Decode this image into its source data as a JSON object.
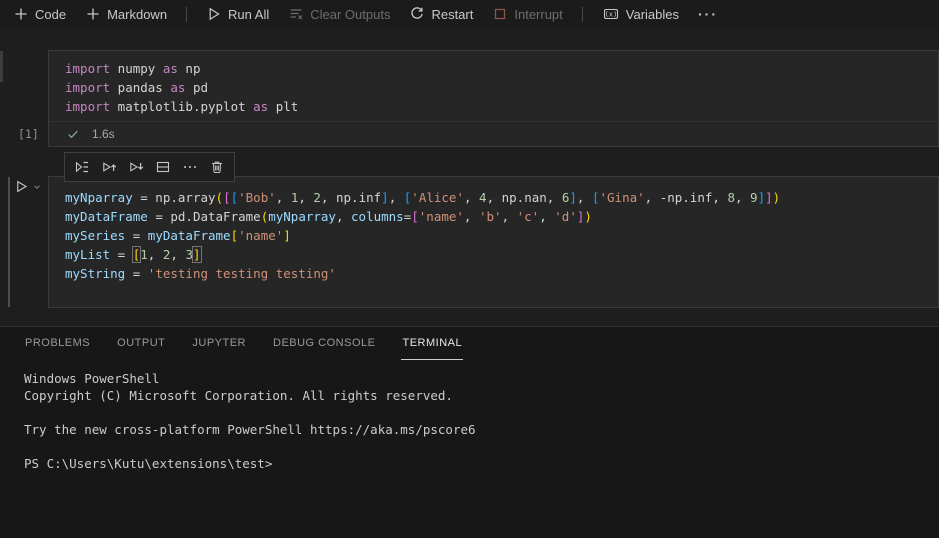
{
  "colors": {
    "kw": "#C586C0",
    "txt": "#D4D4D4",
    "var": "#9CDCFE",
    "str": "#CE9178",
    "num": "#B5CEA8",
    "b1": "#FFD700",
    "b2": "#DA70D6",
    "b3": "#179FFF",
    "success_check": "#7FAE87",
    "interrupt_icon": "#8A564C"
  },
  "toolbar": {
    "code_label": "Code",
    "markdown_label": "Markdown",
    "run_all_label": "Run All",
    "clear_outputs_label": "Clear Outputs",
    "restart_label": "Restart",
    "interrupt_label": "Interrupt",
    "variables_label": "Variables",
    "more_label": "···"
  },
  "cell1": {
    "execution_count": "[1]",
    "status_time": "1.6s",
    "lines": [
      [
        {
          "c": "kw",
          "t": "import"
        },
        {
          "c": "txt",
          "t": " numpy "
        },
        {
          "c": "kw",
          "t": "as"
        },
        {
          "c": "txt",
          "t": " np"
        }
      ],
      [
        {
          "c": "kw",
          "t": "import"
        },
        {
          "c": "txt",
          "t": " pandas "
        },
        {
          "c": "kw",
          "t": "as"
        },
        {
          "c": "txt",
          "t": " pd"
        }
      ],
      [
        {
          "c": "kw",
          "t": "import"
        },
        {
          "c": "txt",
          "t": " matplotlib.pyplot "
        },
        {
          "c": "kw",
          "t": "as"
        },
        {
          "c": "txt",
          "t": " plt"
        }
      ]
    ]
  },
  "cell2": {
    "lines": [
      [
        {
          "c": "var",
          "t": "myNparray"
        },
        {
          "c": "txt",
          "t": " = np.array"
        },
        {
          "c": "b1",
          "t": "("
        },
        {
          "c": "b2",
          "t": "["
        },
        {
          "c": "b3",
          "t": "["
        },
        {
          "c": "str",
          "t": "'Bob'"
        },
        {
          "c": "txt",
          "t": ", "
        },
        {
          "c": "num",
          "t": "1"
        },
        {
          "c": "txt",
          "t": ", "
        },
        {
          "c": "num",
          "t": "2"
        },
        {
          "c": "txt",
          "t": ", np.inf"
        },
        {
          "c": "b3",
          "t": "]"
        },
        {
          "c": "txt",
          "t": ", "
        },
        {
          "c": "b3",
          "t": "["
        },
        {
          "c": "str",
          "t": "'Alice'"
        },
        {
          "c": "txt",
          "t": ", "
        },
        {
          "c": "num",
          "t": "4"
        },
        {
          "c": "txt",
          "t": ", np.nan, "
        },
        {
          "c": "num",
          "t": "6"
        },
        {
          "c": "b3",
          "t": "]"
        },
        {
          "c": "txt",
          "t": ", "
        },
        {
          "c": "b3",
          "t": "["
        },
        {
          "c": "str",
          "t": "'Gina'"
        },
        {
          "c": "txt",
          "t": ", -np.inf, "
        },
        {
          "c": "num",
          "t": "8"
        },
        {
          "c": "txt",
          "t": ", "
        },
        {
          "c": "num",
          "t": "9"
        },
        {
          "c": "b3",
          "t": "]"
        },
        {
          "c": "b2",
          "t": "]"
        },
        {
          "c": "b1",
          "t": ")"
        }
      ],
      [
        {
          "c": "var",
          "t": "myDataFrame"
        },
        {
          "c": "txt",
          "t": " = pd.DataFrame"
        },
        {
          "c": "b1",
          "t": "("
        },
        {
          "c": "var",
          "t": "myNparray"
        },
        {
          "c": "txt",
          "t": ", "
        },
        {
          "c": "var",
          "t": "columns"
        },
        {
          "c": "txt",
          "t": "="
        },
        {
          "c": "b2",
          "t": "["
        },
        {
          "c": "str",
          "t": "'name'"
        },
        {
          "c": "txt",
          "t": ", "
        },
        {
          "c": "str",
          "t": "'b'"
        },
        {
          "c": "txt",
          "t": ", "
        },
        {
          "c": "str",
          "t": "'c'"
        },
        {
          "c": "txt",
          "t": ", "
        },
        {
          "c": "str",
          "t": "'d'"
        },
        {
          "c": "b2",
          "t": "]"
        },
        {
          "c": "b1",
          "t": ")"
        }
      ],
      [
        {
          "c": "var",
          "t": "mySeries"
        },
        {
          "c": "txt",
          "t": " = "
        },
        {
          "c": "var",
          "t": "myDataFrame"
        },
        {
          "c": "b1",
          "t": "["
        },
        {
          "c": "str",
          "t": "'name'"
        },
        {
          "c": "b1",
          "t": "]"
        }
      ],
      [
        {
          "c": "var",
          "t": "myList"
        },
        {
          "c": "txt",
          "t": " = "
        },
        {
          "c": "b1",
          "t": "[",
          "m": true
        },
        {
          "c": "num",
          "t": "1"
        },
        {
          "c": "txt",
          "t": ", "
        },
        {
          "c": "num",
          "t": "2"
        },
        {
          "c": "txt",
          "t": ", "
        },
        {
          "c": "num",
          "t": "3"
        },
        {
          "c": "b1",
          "t": "]",
          "m": true
        }
      ],
      [
        {
          "c": "var",
          "t": "myString"
        },
        {
          "c": "txt",
          "t": " = "
        },
        {
          "c": "str",
          "t": "'testing testing testing'"
        }
      ]
    ]
  },
  "panel": {
    "tabs": {
      "problems": "PROBLEMS",
      "output": "OUTPUT",
      "jupyter": "JUPYTER",
      "debug_console": "DEBUG CONSOLE",
      "terminal": "TERMINAL"
    },
    "active_tab": "TERMINAL",
    "terminal_lines": [
      "Windows PowerShell",
      "Copyright (C) Microsoft Corporation. All rights reserved.",
      "",
      "Try the new cross-platform PowerShell https://aka.ms/pscore6",
      "",
      "PS C:\\Users\\Kutu\\extensions\\test>"
    ]
  }
}
